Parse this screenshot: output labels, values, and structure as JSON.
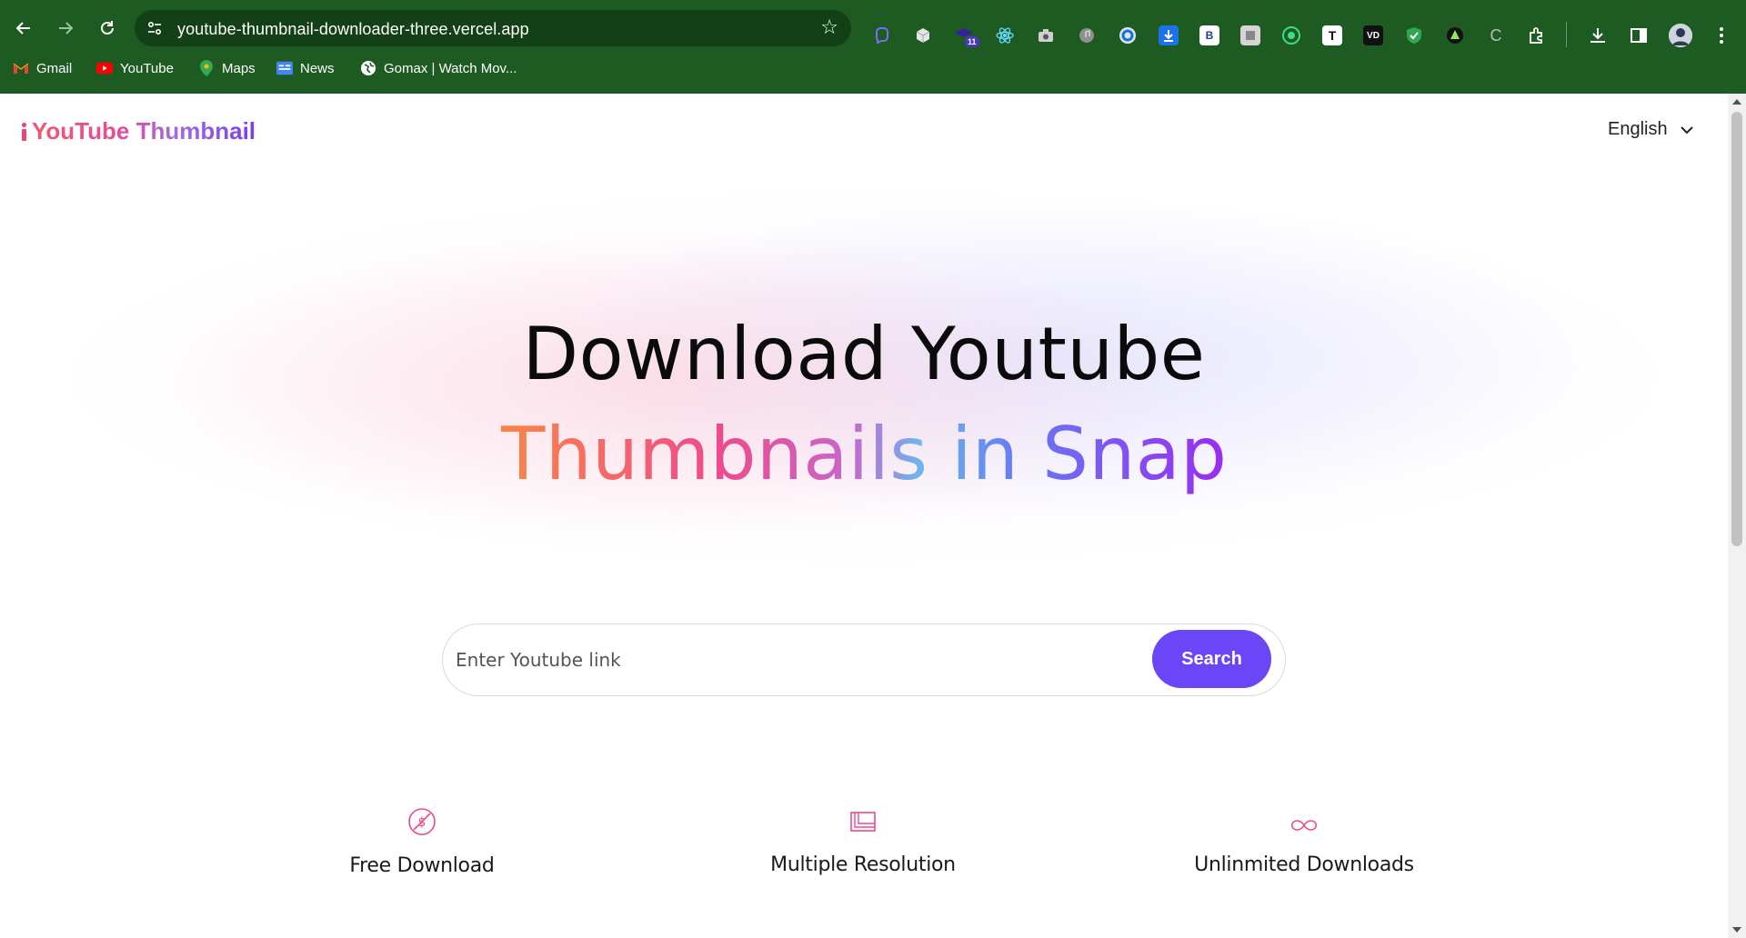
{
  "browser": {
    "url": "youtube-thumbnail-downloader-three.vercel.app",
    "extension_badge": "11",
    "bookmarks": [
      {
        "label": "Gmail",
        "icon": "gmail-icon"
      },
      {
        "label": "YouTube",
        "icon": "youtube-icon"
      },
      {
        "label": "Maps",
        "icon": "maps-icon"
      },
      {
        "label": "News",
        "icon": "news-icon"
      },
      {
        "label": "Gomax | Watch Mov...",
        "icon": "globe-icon"
      }
    ],
    "colors": {
      "frame": "#1e5b23",
      "omnibox": "#134016"
    }
  },
  "header": {
    "logo_text": "YouTube Thumbnail",
    "language": "English"
  },
  "hero": {
    "line1": "Download Youtube",
    "line2": "Thumbnails in Snap"
  },
  "search": {
    "placeholder": "Enter Youtube link",
    "button_label": "Search",
    "accent": "#6b46f6"
  },
  "features": [
    {
      "label": "Free Download",
      "icon": "no-cost-icon"
    },
    {
      "label": "Multiple Resolution",
      "icon": "resolution-icon"
    },
    {
      "label": "Unlinmited Downloads",
      "icon": "infinity-icon"
    }
  ]
}
